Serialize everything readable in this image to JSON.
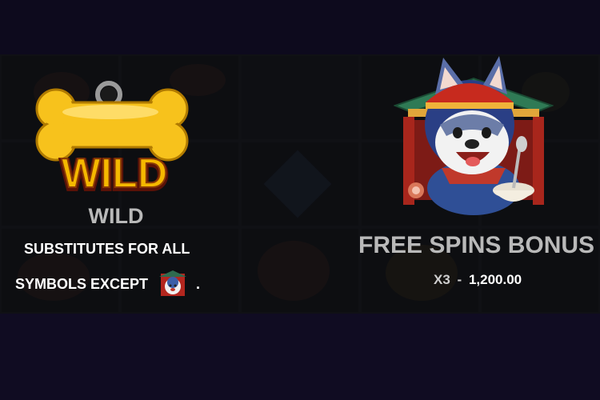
{
  "colors": {
    "background": "#0f0b1f",
    "title_gray": "#b9b9b9",
    "text_white": "#ffffff",
    "wild_gold": "#f5b800",
    "wild_red": "#c0391f"
  },
  "wild": {
    "symbol_icon": "bone-wild-icon",
    "logo_text": "WILD",
    "title": "WILD",
    "desc_line1": "SUBSTITUTES FOR ALL",
    "desc_line2": "SYMBOLS EXCEPT",
    "except_icon": "husky-bonus-icon",
    "period": "."
  },
  "bonus": {
    "symbol_icon": "husky-chef-icon",
    "title": "FREE SPINS BONUS",
    "multiplier": "X3",
    "dash": "-",
    "amount": "1,200.00"
  }
}
